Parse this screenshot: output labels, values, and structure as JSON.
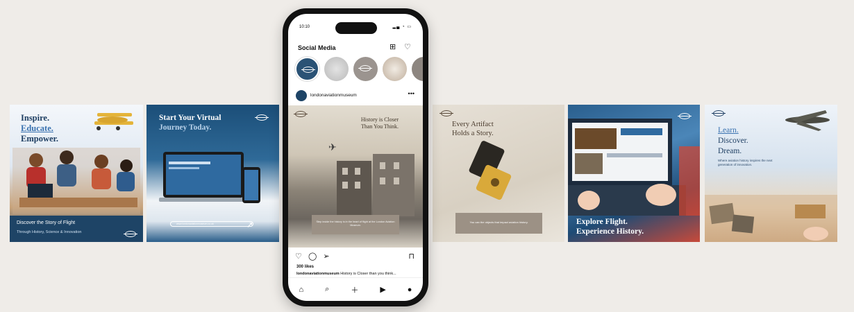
{
  "tiles": {
    "t1": {
      "line1": "Inspire.",
      "line2": "Educate.",
      "line3": "Empower.",
      "band_title": "Discover the Story of Flight",
      "band_sub": "Through History, Science & Innovation"
    },
    "t2": {
      "line1": "Start Your Virtual",
      "line2": "Journey Today.",
      "url": "www.londonaviationmuseum.co.uk"
    },
    "t3": {
      "line1": "Every Artifact",
      "line2": "Holds a Story.",
      "caption": "You can the objects that impact aviation history."
    },
    "t4": {
      "line1": "Explore Flight.",
      "line2": "Experience History."
    },
    "t5": {
      "line1": "Learn.",
      "line2": "Discover.",
      "line3": "Dream.",
      "sub": "Where aviation history inspires the next generation of innovation."
    }
  },
  "phone": {
    "status_time": "10:10",
    "app_title": "Social Media",
    "account": "londonaviationmuseum",
    "post_headline_1": "History is Closer",
    "post_headline_2": "Than You Think.",
    "post_caption": "Step inside the history is in the heart of flight at the London Aviation Museum.",
    "likes": "300 likes",
    "caption_user": "londonaviationmuseum",
    "caption_text": "History is Closer than you think..."
  },
  "icons": [
    "plus-square-icon",
    "heart-icon",
    "more-icon",
    "like-icon",
    "comment-icon",
    "share-icon",
    "bookmark-icon",
    "home-icon",
    "search-icon",
    "add-icon",
    "reels-icon",
    "profile-icon"
  ]
}
